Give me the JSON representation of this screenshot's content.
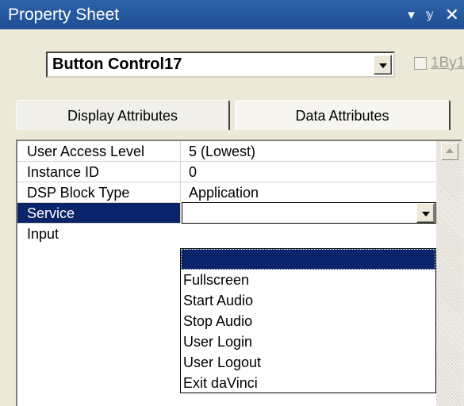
{
  "window": {
    "title": "Property Sheet"
  },
  "title_controls": {
    "menu_glyph": "▾",
    "pin_glyph": "ᵃ",
    "close_glyph": "✕"
  },
  "object_selector": {
    "value": "Button Control17"
  },
  "one_by_one": {
    "label": "1By1",
    "checked": false
  },
  "tabs": [
    {
      "label": "Display Attributes",
      "active": false
    },
    {
      "label": "Data Attributes",
      "active": true
    }
  ],
  "properties": [
    {
      "name": "User Access Level",
      "value": "5 (Lowest)"
    },
    {
      "name": "Instance ID",
      "value": "0"
    },
    {
      "name": "DSP Block Type",
      "value": "Application"
    },
    {
      "name": "Service",
      "value": ""
    },
    {
      "name": "Input",
      "value": ""
    }
  ],
  "service_dropdown": {
    "options": [
      "",
      "Fullscreen",
      "Start Audio",
      "Stop Audio",
      "User Login",
      "User Logout",
      "Exit daVinci"
    ]
  },
  "colors": {
    "title_bar": "#1f4f95",
    "selection": "#0a246a",
    "panel": "#ece9d8"
  }
}
